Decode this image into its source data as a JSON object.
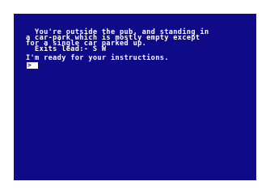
{
  "game": {
    "description_lines": [
      "  You're outside the pub, and standing in",
      "a car-park which is mostly empty except",
      "for a single car parked up.",
      "  Exits lead:- S W"
    ],
    "ready_message": "I'm ready for your instructions.",
    "prompt_symbol": ">",
    "colors": {
      "screen_background": "#0f0a87",
      "text": "#ffffff",
      "outer_border": "#ffffff"
    }
  }
}
